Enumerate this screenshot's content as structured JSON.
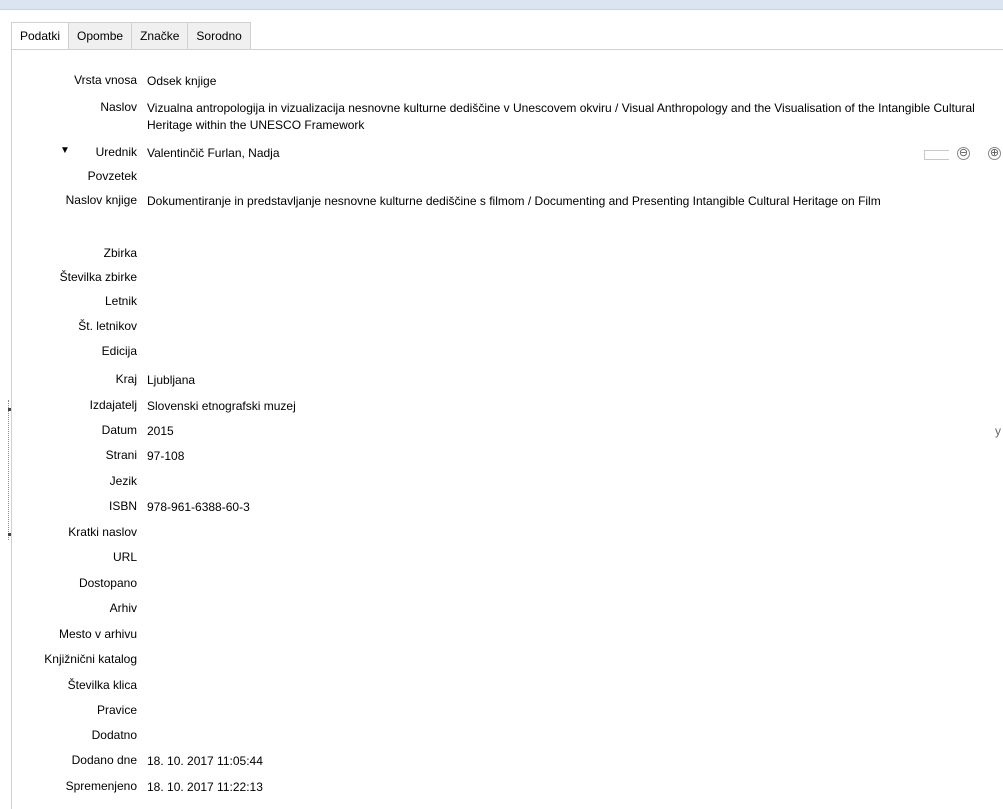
{
  "tabs": [
    {
      "label": "Podatki",
      "active": true
    },
    {
      "label": "Opombe",
      "active": false
    },
    {
      "label": "Značke",
      "active": false
    },
    {
      "label": "Sorodno",
      "active": false
    }
  ],
  "fields": {
    "item_type": {
      "label": "Vrsta vnosa",
      "value": "Odsek knjige"
    },
    "title": {
      "label": "Naslov",
      "value": "Vizualna antropologija in vizualizacija nesnovne kulturne dediščine v Unescovem okviru / Visual Anthropology and the Visualisation of the Intangible Cultural Heritage within the UNESCO Framework"
    },
    "editor": {
      "label": "Urednik",
      "value": "Valentinčič Furlan, Nadja"
    },
    "abstract": {
      "label": "Povzetek",
      "value": ""
    },
    "book_title": {
      "label": "Naslov knjige",
      "value": "Dokumentiranje in predstavljanje nesnovne kulturne dediščine s filmom / Documenting and Presenting Intangible Cultural Heritage on Film"
    },
    "series": {
      "label": "Zbirka",
      "value": ""
    },
    "series_number": {
      "label": "Številka zbirke",
      "value": ""
    },
    "volume": {
      "label": "Letnik",
      "value": ""
    },
    "num_volumes": {
      "label": "Št. letnikov",
      "value": ""
    },
    "edition": {
      "label": "Edicija",
      "value": ""
    },
    "place": {
      "label": "Kraj",
      "value": "Ljubljana"
    },
    "publisher": {
      "label": "Izdajatelj",
      "value": "Slovenski etnografski muzej"
    },
    "date": {
      "label": "Datum",
      "value": "2015",
      "suffix": "y"
    },
    "pages": {
      "label": "Strani",
      "value": "97-108"
    },
    "language": {
      "label": "Jezik",
      "value": ""
    },
    "isbn": {
      "label": "ISBN",
      "value": "978-961-6388-60-3"
    },
    "short_title": {
      "label": "Kratki naslov",
      "value": ""
    },
    "url": {
      "label": "URL",
      "value": ""
    },
    "accessed": {
      "label": "Dostopano",
      "value": ""
    },
    "archive": {
      "label": "Arhiv",
      "value": ""
    },
    "archive_location": {
      "label": "Mesto v arhivu",
      "value": ""
    },
    "library_catalog": {
      "label": "Knjižnični katalog",
      "value": ""
    },
    "call_number": {
      "label": "Številka klica",
      "value": ""
    },
    "rights": {
      "label": "Pravice",
      "value": ""
    },
    "extra": {
      "label": "Dodatno",
      "value": ""
    },
    "date_added": {
      "label": "Dodano dne",
      "value": "18. 10. 2017 11:05:44"
    },
    "modified": {
      "label": "Spremenjeno",
      "value": "18. 10. 2017 11:22:13"
    }
  },
  "creator_controls": {
    "minus": "⊖",
    "plus": "⊕"
  },
  "icons": {
    "expand": "chevron-down-icon",
    "remove": "minus-circle-icon",
    "add": "plus-circle-icon"
  }
}
